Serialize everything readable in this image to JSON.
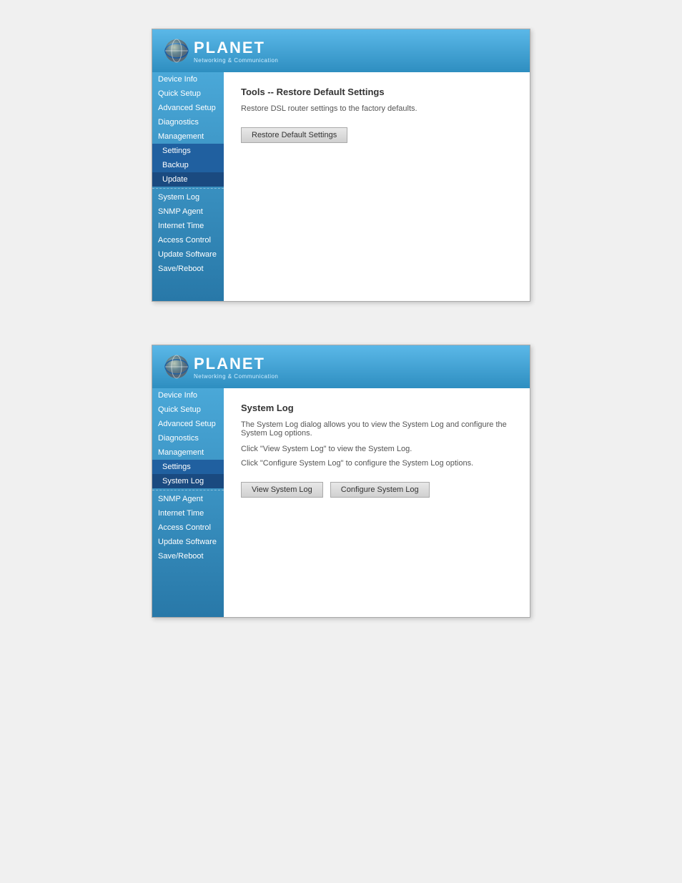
{
  "panels": [
    {
      "id": "panel1",
      "logo": {
        "planet_text": "PLANET",
        "subtitle": "Networking & Communication"
      },
      "sidebar": {
        "items": [
          {
            "label": "Device Info",
            "level": "top",
            "active": false
          },
          {
            "label": "Quick Setup",
            "level": "top",
            "active": false
          },
          {
            "label": "Advanced Setup",
            "level": "top",
            "active": false
          },
          {
            "label": "Diagnostics",
            "level": "top",
            "active": false
          },
          {
            "label": "Management",
            "level": "top",
            "active": false
          },
          {
            "label": "Settings",
            "level": "sub",
            "active": false
          },
          {
            "label": "Backup",
            "level": "sub",
            "active": false
          },
          {
            "label": "Update",
            "level": "sub",
            "active": true
          },
          {
            "label": "System Log",
            "level": "top",
            "active": false
          },
          {
            "label": "SNMP Agent",
            "level": "top",
            "active": false
          },
          {
            "label": "Internet Time",
            "level": "top",
            "active": false
          },
          {
            "label": "Access Control",
            "level": "top",
            "active": false
          },
          {
            "label": "Update Software",
            "level": "top",
            "active": false
          },
          {
            "label": "Save/Reboot",
            "level": "top",
            "active": false
          }
        ]
      },
      "main": {
        "title": "Tools -- Restore Default Settings",
        "description": "Restore DSL router settings to the factory defaults.",
        "buttons": [
          {
            "label": "Restore Default Settings"
          }
        ]
      }
    },
    {
      "id": "panel2",
      "logo": {
        "planet_text": "PLANET",
        "subtitle": "Networking & Communication"
      },
      "sidebar": {
        "items": [
          {
            "label": "Device Info",
            "level": "top",
            "active": false
          },
          {
            "label": "Quick Setup",
            "level": "top",
            "active": false
          },
          {
            "label": "Advanced Setup",
            "level": "top",
            "active": false
          },
          {
            "label": "Diagnostics",
            "level": "top",
            "active": false
          },
          {
            "label": "Management",
            "level": "top",
            "active": false
          },
          {
            "label": "Settings",
            "level": "sub",
            "active": false
          },
          {
            "label": "System Log",
            "level": "sub",
            "active": true
          },
          {
            "label": "SNMP Agent",
            "level": "top",
            "active": false
          },
          {
            "label": "Internet Time",
            "level": "top",
            "active": false
          },
          {
            "label": "Access Control",
            "level": "top",
            "active": false
          },
          {
            "label": "Update Software",
            "level": "top",
            "active": false
          },
          {
            "label": "Save/Reboot",
            "level": "top",
            "active": false
          }
        ]
      },
      "main": {
        "title": "System Log",
        "description_lines": [
          "The System Log dialog allows you to view the System Log and configure the System Log options.",
          "Click \"View System Log\" to view the System Log.",
          "Click \"Configure System Log\" to configure the System Log options."
        ],
        "buttons": [
          {
            "label": "View System Log"
          },
          {
            "label": "Configure System Log"
          }
        ]
      }
    }
  ]
}
